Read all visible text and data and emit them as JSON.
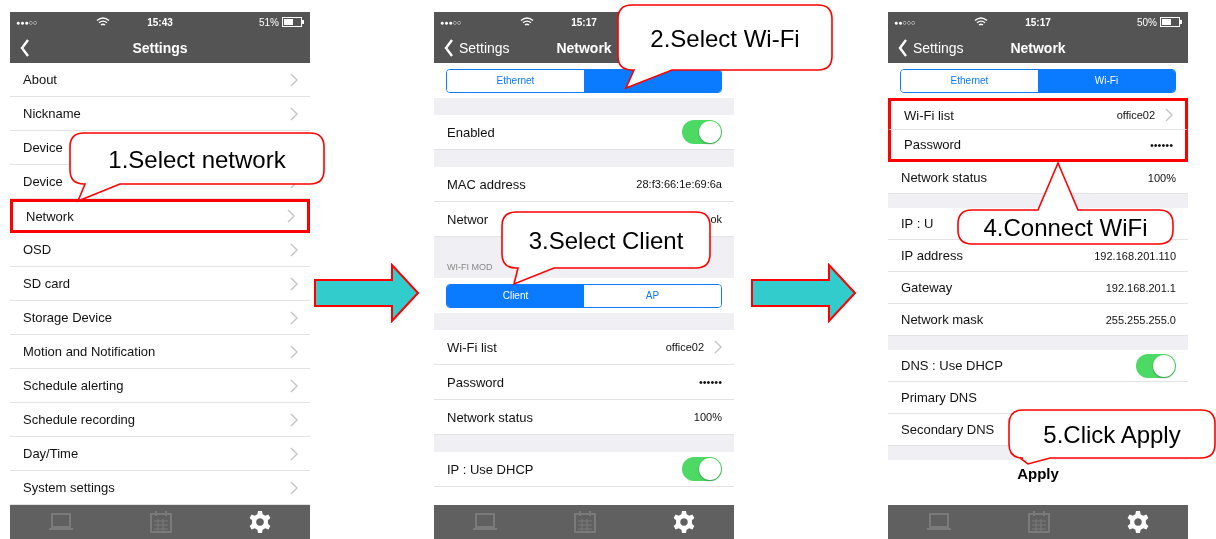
{
  "phones": [
    {
      "status": {
        "signal": "●●●○○",
        "time": "15:43",
        "battery": "51%"
      },
      "nav": {
        "title": "Settings"
      },
      "rows": [
        {
          "kind": "link",
          "label": "About"
        },
        {
          "kind": "link",
          "label": "Nickname"
        },
        {
          "kind": "link",
          "label": "Device"
        },
        {
          "kind": "link",
          "label": "Device"
        },
        {
          "kind": "link",
          "label": "Network",
          "highlighted": true
        },
        {
          "kind": "link",
          "label": "OSD"
        },
        {
          "kind": "link",
          "label": "SD card"
        },
        {
          "kind": "link",
          "label": "Storage Device"
        },
        {
          "kind": "link",
          "label": "Motion and Notification"
        },
        {
          "kind": "link",
          "label": "Schedule alerting"
        },
        {
          "kind": "link",
          "label": "Schedule recording"
        },
        {
          "kind": "link",
          "label": "Day/Time"
        },
        {
          "kind": "link",
          "label": "System settings"
        }
      ],
      "callouts": [
        {
          "text": "1.Select network"
        }
      ],
      "tabs": [
        {
          "selected": false
        },
        {
          "selected": false
        },
        {
          "selected": true
        }
      ]
    },
    {
      "status": {
        "signal": "●●●○○",
        "time": "15:17"
      },
      "nav": {
        "back": "Settings",
        "title": "Network"
      },
      "rows": [
        {
          "kind": "segmented",
          "segments": [
            {
              "label": "Ethernet",
              "selected": false
            },
            {
              "selected": true
            }
          ]
        },
        {
          "kind": "gap"
        },
        {
          "kind": "toggle",
          "label": "Enabled",
          "on": true
        },
        {
          "kind": "gap"
        },
        {
          "kind": "value",
          "label": "MAC address",
          "value": "28:f3:66:1e:69:6a"
        },
        {
          "kind": "value",
          "label": "Networ",
          "value": "ok"
        },
        {
          "kind": "header",
          "label": "WI-FI MOD"
        },
        {
          "kind": "segmented",
          "segments": [
            {
              "label": "Client",
              "selected": true
            },
            {
              "label": "AP",
              "selected": false
            }
          ]
        },
        {
          "kind": "gap"
        },
        {
          "kind": "link",
          "label": "Wi-Fi list",
          "value": "office02"
        },
        {
          "kind": "value",
          "label": "Password",
          "value": "••••••"
        },
        {
          "kind": "value",
          "label": "Network status",
          "value": "100%"
        },
        {
          "kind": "gap"
        },
        {
          "kind": "toggle",
          "label": "IP : Use DHCP",
          "on": true
        }
      ],
      "callouts": [
        {
          "text": "2.Select Wi-Fi"
        },
        {
          "text": "3.Select Client"
        }
      ],
      "tabs": [
        {
          "selected": false
        },
        {
          "selected": false
        },
        {
          "selected": true
        }
      ]
    },
    {
      "status": {
        "signal": "●●○○○",
        "time": "15:17",
        "battery": "50%"
      },
      "nav": {
        "back": "Settings",
        "title": "Network"
      },
      "rows": [
        {
          "kind": "segmented",
          "segments": [
            {
              "label": "Ethernet",
              "selected": false
            },
            {
              "label": "Wi-Fi",
              "selected": true
            }
          ]
        },
        {
          "kind": "link",
          "label": "Wi-Fi list",
          "value": "office02",
          "highlighted": true
        },
        {
          "kind": "value",
          "label": "Password",
          "value": "••••••",
          "highlighted": true
        },
        {
          "kind": "value",
          "label": "Network status",
          "value": "100%"
        },
        {
          "kind": "gap"
        },
        {
          "kind": "value",
          "label": "IP : U"
        },
        {
          "kind": "value",
          "label": "IP address",
          "value": "192.168.201.110"
        },
        {
          "kind": "value",
          "label": "Gateway",
          "value": "192.168.201.1"
        },
        {
          "kind": "value",
          "label": "Network mask",
          "value": "255.255.255.0"
        },
        {
          "kind": "gap"
        },
        {
          "kind": "toggle",
          "label": "DNS : Use DHCP",
          "on": true
        },
        {
          "kind": "value",
          "label": "Primary DNS"
        },
        {
          "kind": "value",
          "label": "Secondary DNS"
        },
        {
          "kind": "gap"
        },
        {
          "kind": "button",
          "label": "Apply"
        }
      ],
      "callouts": [
        {
          "text": "4.Connect WiFi"
        },
        {
          "text": "5.Click Apply"
        }
      ],
      "tabs": [
        {
          "selected": false
        },
        {
          "selected": false
        },
        {
          "selected": true
        }
      ]
    }
  ]
}
